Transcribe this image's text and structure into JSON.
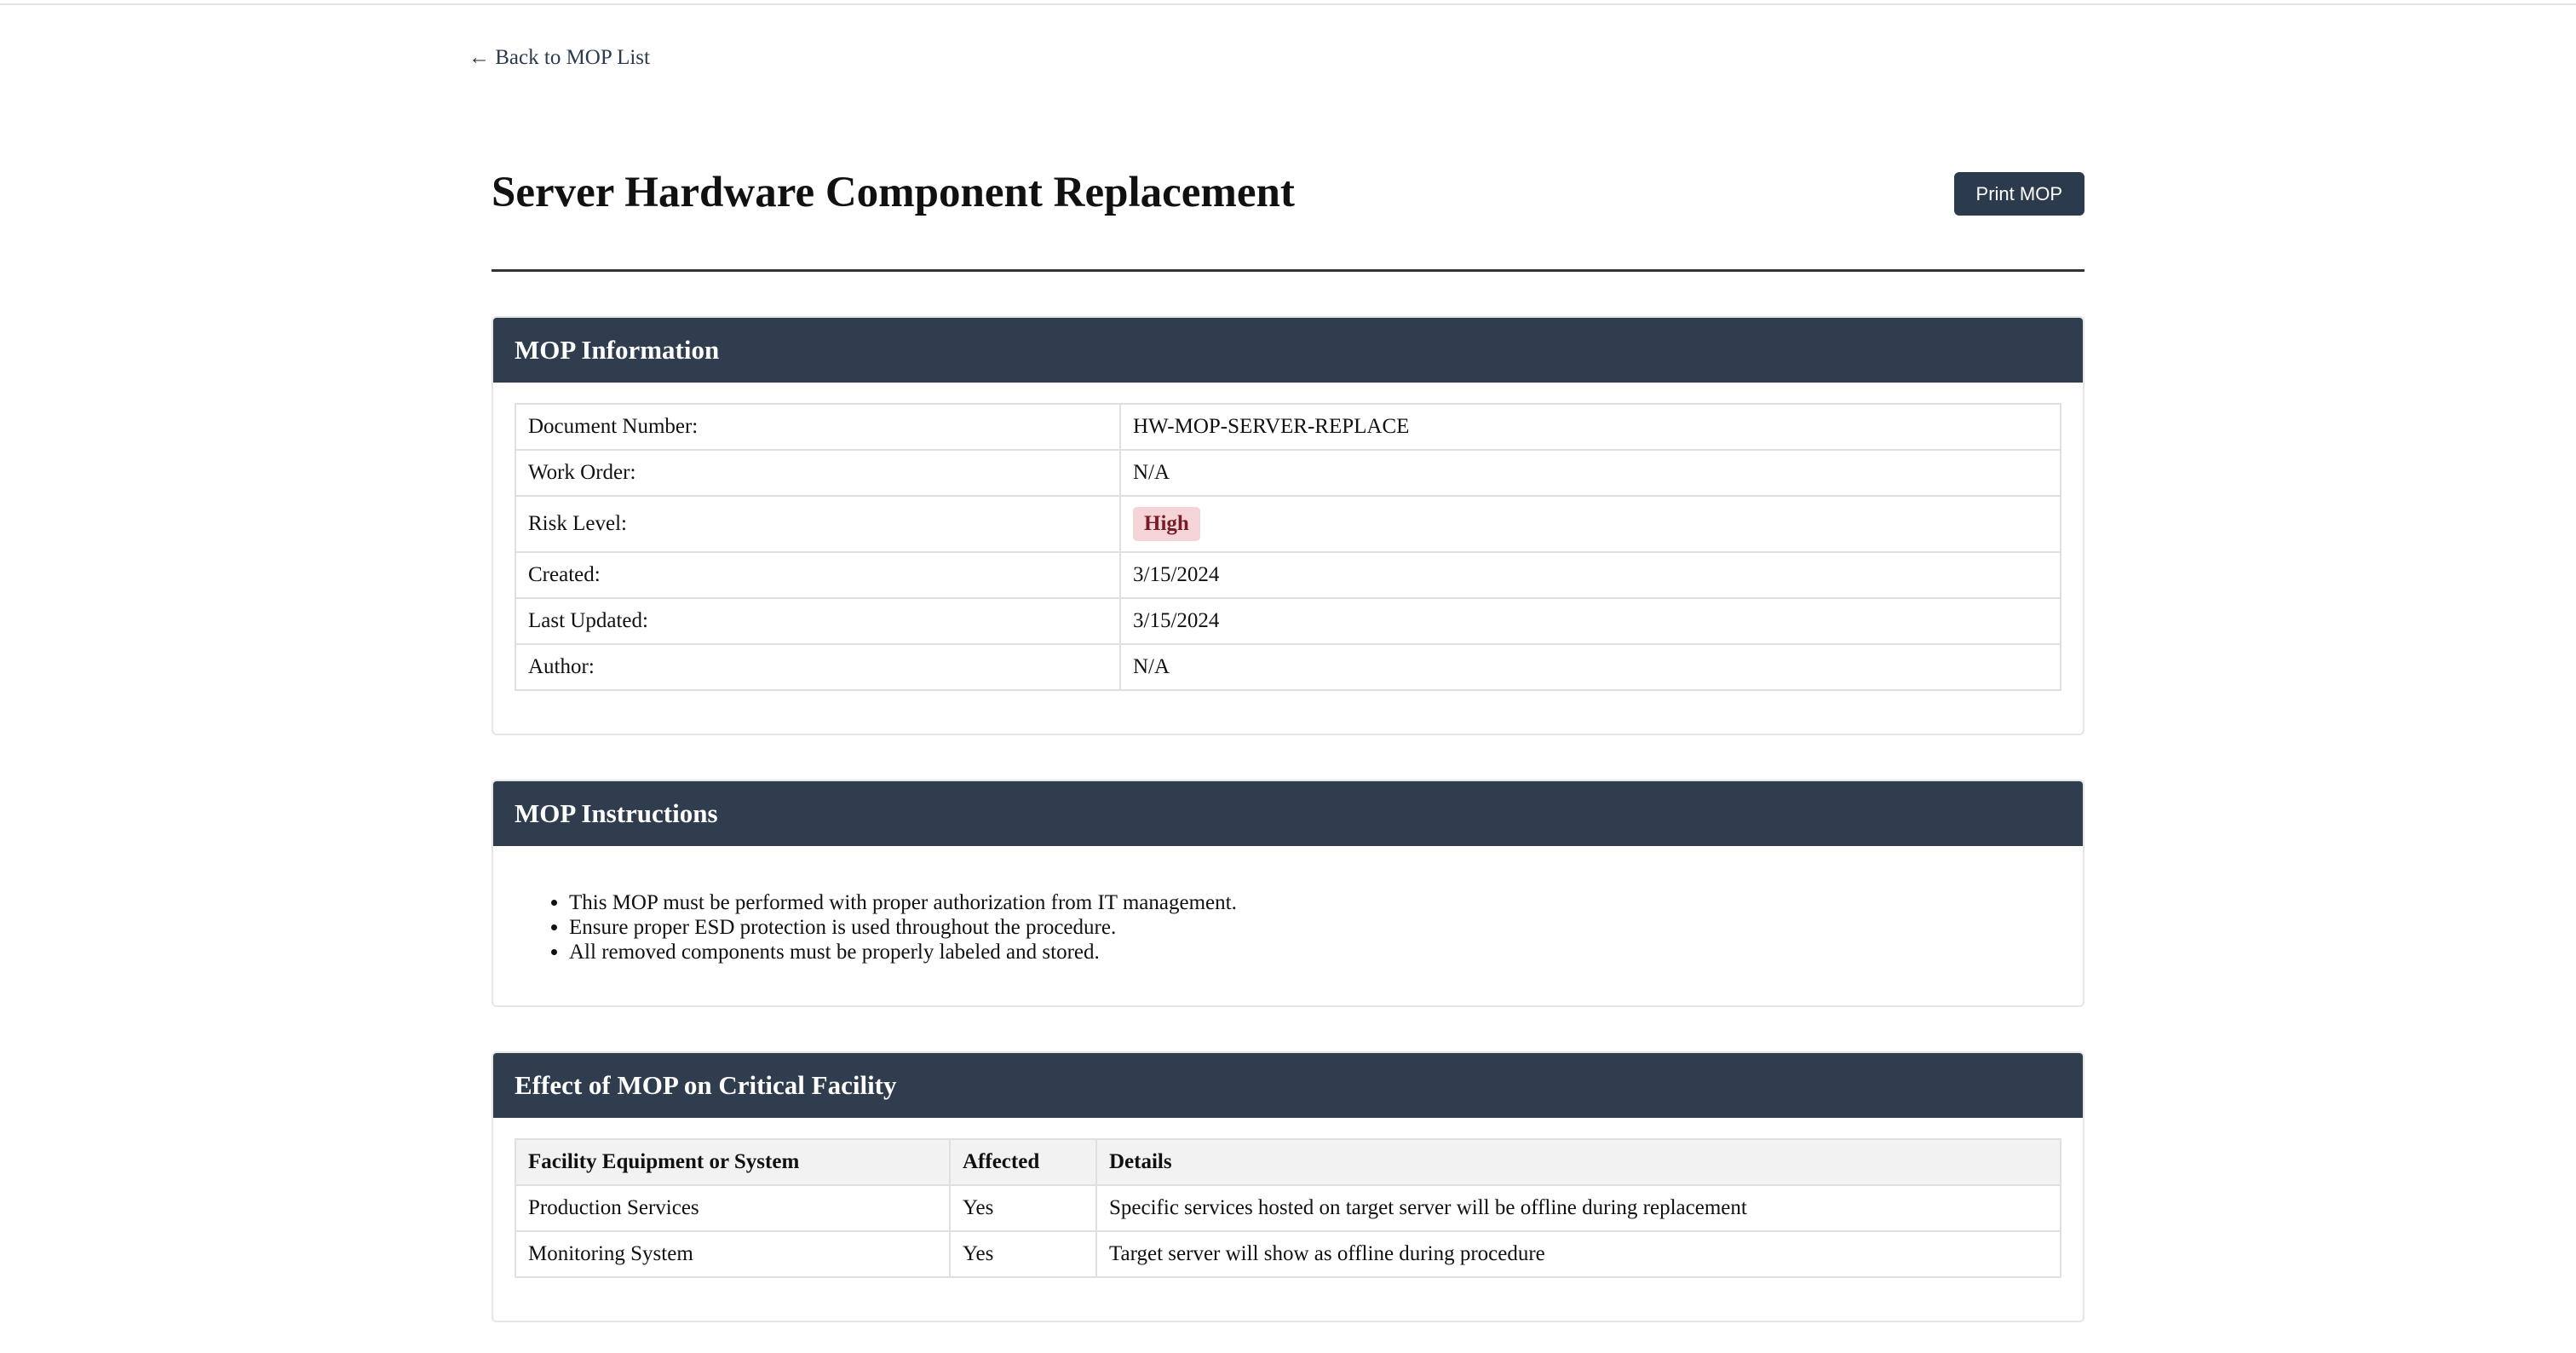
{
  "nav": {
    "back_arrow": "←",
    "back_label": "Back to MOP List"
  },
  "header": {
    "title": "Server Hardware Component Replacement",
    "print_label": "Print MOP"
  },
  "info": {
    "heading": "MOP Information",
    "rows": [
      {
        "label": "Document Number:",
        "value": "HW-MOP-SERVER-REPLACE"
      },
      {
        "label": "Work Order:",
        "value": "N/A"
      },
      {
        "label": "Risk Level:",
        "value": "High"
      },
      {
        "label": "Created:",
        "value": "3/15/2024"
      },
      {
        "label": "Last Updated:",
        "value": "3/15/2024"
      },
      {
        "label": "Author:",
        "value": "N/A"
      }
    ]
  },
  "instructions": {
    "heading": "MOP Instructions",
    "items": [
      "This MOP must be performed with proper authorization from IT management.",
      "Ensure proper ESD protection is used throughout the procedure.",
      "All removed components must be properly labeled and stored."
    ]
  },
  "effect": {
    "heading": "Effect of MOP on Critical Facility",
    "columns": [
      "Facility Equipment or System",
      "Affected",
      "Details"
    ],
    "rows": [
      [
        "Production Services",
        "Yes",
        "Specific services hosted on target server will be offline during replacement"
      ],
      [
        "Monitoring System",
        "Yes",
        "Target server will show as offline during procedure"
      ]
    ]
  },
  "colors": {
    "header_bg": "#2f3d4f",
    "button_bg": "#2c3a4e",
    "risk_badge_bg": "#f4d4d6",
    "risk_badge_text": "#7a1c28"
  }
}
